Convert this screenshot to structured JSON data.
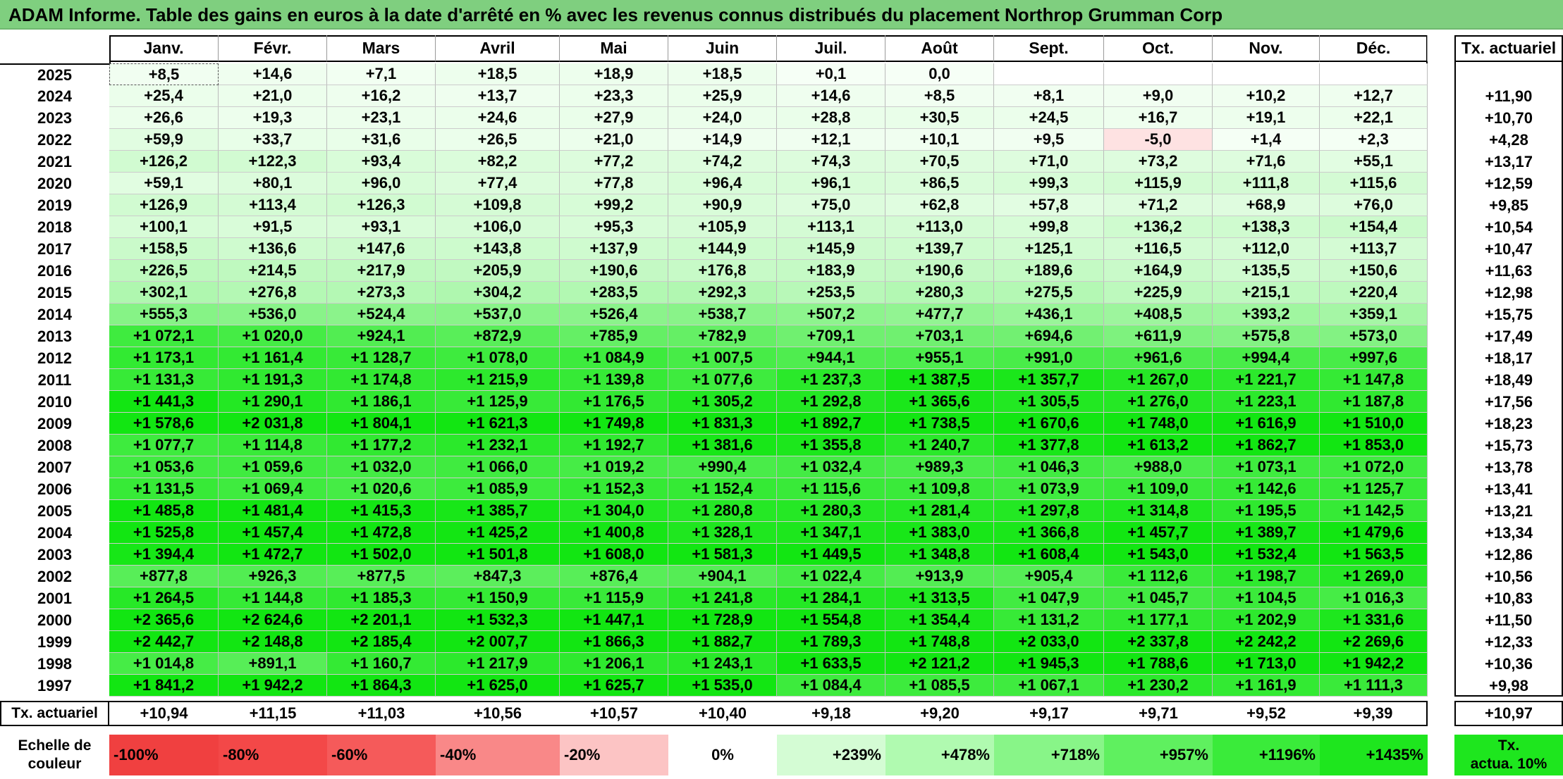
{
  "title": "ADAM Informe. Table des gains en euros à la date d'arrêté en % avec les revenus connus distribués du placement Northrop Grumman Corp",
  "chart_data": {
    "type": "table",
    "columns": [
      "Janv.",
      "Févr.",
      "Mars",
      "Avril",
      "Mai",
      "Juin",
      "Juil.",
      "Août",
      "Sept.",
      "Oct.",
      "Nov.",
      "Déc."
    ],
    "annual_column_label": "Tx. actuariel",
    "rows": [
      {
        "year": "2025",
        "values": [
          "+8,5",
          "+14,6",
          "+7,1",
          "+18,5",
          "+18,9",
          "+18,5",
          "+0,1",
          "0,0",
          "",
          "",
          "",
          ""
        ],
        "annual": ""
      },
      {
        "year": "2024",
        "values": [
          "+25,4",
          "+21,0",
          "+16,2",
          "+13,7",
          "+23,3",
          "+25,9",
          "+14,6",
          "+8,5",
          "+8,1",
          "+9,0",
          "+10,2",
          "+12,7"
        ],
        "annual": "+11,90"
      },
      {
        "year": "2023",
        "values": [
          "+26,6",
          "+19,3",
          "+23,1",
          "+24,6",
          "+27,9",
          "+24,0",
          "+28,8",
          "+30,5",
          "+24,5",
          "+16,7",
          "+19,1",
          "+22,1"
        ],
        "annual": "+10,70"
      },
      {
        "year": "2022",
        "values": [
          "+59,9",
          "+33,7",
          "+31,6",
          "+26,5",
          "+21,0",
          "+14,9",
          "+12,1",
          "+10,1",
          "+9,5",
          "-5,0",
          "+1,4",
          "+2,3"
        ],
        "annual": "+4,28"
      },
      {
        "year": "2021",
        "values": [
          "+126,2",
          "+122,3",
          "+93,4",
          "+82,2",
          "+77,2",
          "+74,2",
          "+74,3",
          "+70,5",
          "+71,0",
          "+73,2",
          "+71,6",
          "+55,1"
        ],
        "annual": "+13,17"
      },
      {
        "year": "2020",
        "values": [
          "+59,1",
          "+80,1",
          "+96,0",
          "+77,4",
          "+77,8",
          "+96,4",
          "+96,1",
          "+86,5",
          "+99,3",
          "+115,9",
          "+111,8",
          "+115,6"
        ],
        "annual": "+12,59"
      },
      {
        "year": "2019",
        "values": [
          "+126,9",
          "+113,4",
          "+126,3",
          "+109,8",
          "+99,2",
          "+90,9",
          "+75,0",
          "+62,8",
          "+57,8",
          "+71,2",
          "+68,9",
          "+76,0"
        ],
        "annual": "+9,85"
      },
      {
        "year": "2018",
        "values": [
          "+100,1",
          "+91,5",
          "+93,1",
          "+106,0",
          "+95,3",
          "+105,9",
          "+113,1",
          "+113,0",
          "+99,8",
          "+136,2",
          "+138,3",
          "+154,4"
        ],
        "annual": "+10,54"
      },
      {
        "year": "2017",
        "values": [
          "+158,5",
          "+136,6",
          "+147,6",
          "+143,8",
          "+137,9",
          "+144,9",
          "+145,9",
          "+139,7",
          "+125,1",
          "+116,5",
          "+112,0",
          "+113,7"
        ],
        "annual": "+10,47"
      },
      {
        "year": "2016",
        "values": [
          "+226,5",
          "+214,5",
          "+217,9",
          "+205,9",
          "+190,6",
          "+176,8",
          "+183,9",
          "+190,6",
          "+189,6",
          "+164,9",
          "+135,5",
          "+150,6"
        ],
        "annual": "+11,63"
      },
      {
        "year": "2015",
        "values": [
          "+302,1",
          "+276,8",
          "+273,3",
          "+304,2",
          "+283,5",
          "+292,3",
          "+253,5",
          "+280,3",
          "+275,5",
          "+225,9",
          "+215,1",
          "+220,4"
        ],
        "annual": "+12,98"
      },
      {
        "year": "2014",
        "values": [
          "+555,3",
          "+536,0",
          "+524,4",
          "+537,0",
          "+526,4",
          "+538,7",
          "+507,2",
          "+477,7",
          "+436,1",
          "+408,5",
          "+393,2",
          "+359,1"
        ],
        "annual": "+15,75"
      },
      {
        "year": "2013",
        "values": [
          "+1 072,1",
          "+1 020,0",
          "+924,1",
          "+872,9",
          "+785,9",
          "+782,9",
          "+709,1",
          "+703,1",
          "+694,6",
          "+611,9",
          "+575,8",
          "+573,0"
        ],
        "annual": "+17,49"
      },
      {
        "year": "2012",
        "values": [
          "+1 173,1",
          "+1 161,4",
          "+1 128,7",
          "+1 078,0",
          "+1 084,9",
          "+1 007,5",
          "+944,1",
          "+955,1",
          "+991,0",
          "+961,6",
          "+994,4",
          "+997,6"
        ],
        "annual": "+18,17"
      },
      {
        "year": "2011",
        "values": [
          "+1 131,3",
          "+1 191,3",
          "+1 174,8",
          "+1 215,9",
          "+1 139,8",
          "+1 077,6",
          "+1 237,3",
          "+1 387,5",
          "+1 357,7",
          "+1 267,0",
          "+1 221,7",
          "+1 147,8"
        ],
        "annual": "+18,49"
      },
      {
        "year": "2010",
        "values": [
          "+1 441,3",
          "+1 290,1",
          "+1 186,1",
          "+1 125,9",
          "+1 176,5",
          "+1 305,2",
          "+1 292,8",
          "+1 365,6",
          "+1 305,5",
          "+1 276,0",
          "+1 223,1",
          "+1 187,8"
        ],
        "annual": "+17,56"
      },
      {
        "year": "2009",
        "values": [
          "+1 578,6",
          "+2 031,8",
          "+1 804,1",
          "+1 621,3",
          "+1 749,8",
          "+1 831,3",
          "+1 892,7",
          "+1 738,5",
          "+1 670,6",
          "+1 748,0",
          "+1 616,9",
          "+1 510,0"
        ],
        "annual": "+18,23"
      },
      {
        "year": "2008",
        "values": [
          "+1 077,7",
          "+1 114,8",
          "+1 177,2",
          "+1 232,1",
          "+1 192,7",
          "+1 381,6",
          "+1 355,8",
          "+1 240,7",
          "+1 377,8",
          "+1 613,2",
          "+1 862,7",
          "+1 853,0"
        ],
        "annual": "+15,73"
      },
      {
        "year": "2007",
        "values": [
          "+1 053,6",
          "+1 059,6",
          "+1 032,0",
          "+1 066,0",
          "+1 019,2",
          "+990,4",
          "+1 032,4",
          "+989,3",
          "+1 046,3",
          "+988,0",
          "+1 073,1",
          "+1 072,0"
        ],
        "annual": "+13,78"
      },
      {
        "year": "2006",
        "values": [
          "+1 131,5",
          "+1 069,4",
          "+1 020,6",
          "+1 085,9",
          "+1 152,3",
          "+1 152,4",
          "+1 115,6",
          "+1 109,8",
          "+1 073,9",
          "+1 109,0",
          "+1 142,6",
          "+1 125,7"
        ],
        "annual": "+13,41"
      },
      {
        "year": "2005",
        "values": [
          "+1 485,8",
          "+1 481,4",
          "+1 415,3",
          "+1 385,7",
          "+1 304,0",
          "+1 280,8",
          "+1 280,3",
          "+1 281,4",
          "+1 297,8",
          "+1 314,8",
          "+1 195,5",
          "+1 142,5"
        ],
        "annual": "+13,21"
      },
      {
        "year": "2004",
        "values": [
          "+1 525,8",
          "+1 457,4",
          "+1 472,8",
          "+1 425,2",
          "+1 400,8",
          "+1 328,1",
          "+1 347,1",
          "+1 383,0",
          "+1 366,8",
          "+1 457,7",
          "+1 389,7",
          "+1 479,6"
        ],
        "annual": "+13,34"
      },
      {
        "year": "2003",
        "values": [
          "+1 394,4",
          "+1 472,7",
          "+1 502,0",
          "+1 501,8",
          "+1 608,0",
          "+1 581,3",
          "+1 449,5",
          "+1 348,8",
          "+1 608,4",
          "+1 543,0",
          "+1 532,4",
          "+1 563,5"
        ],
        "annual": "+12,86"
      },
      {
        "year": "2002",
        "values": [
          "+877,8",
          "+926,3",
          "+877,5",
          "+847,3",
          "+876,4",
          "+904,1",
          "+1 022,4",
          "+913,9",
          "+905,4",
          "+1 112,6",
          "+1 198,7",
          "+1 269,0"
        ],
        "annual": "+10,56"
      },
      {
        "year": "2001",
        "values": [
          "+1 264,5",
          "+1 144,8",
          "+1 185,3",
          "+1 150,9",
          "+1 115,9",
          "+1 241,8",
          "+1 284,1",
          "+1 313,5",
          "+1 047,9",
          "+1 045,7",
          "+1 104,5",
          "+1 016,3"
        ],
        "annual": "+10,83"
      },
      {
        "year": "2000",
        "values": [
          "+2 365,6",
          "+2 624,6",
          "+2 201,1",
          "+1 532,3",
          "+1 447,1",
          "+1 728,9",
          "+1 554,8",
          "+1 354,4",
          "+1 131,2",
          "+1 177,1",
          "+1 202,9",
          "+1 331,6"
        ],
        "annual": "+11,50"
      },
      {
        "year": "1999",
        "values": [
          "+2 442,7",
          "+2 148,8",
          "+2 185,4",
          "+2 007,7",
          "+1 866,3",
          "+1 882,7",
          "+1 789,3",
          "+1 748,8",
          "+2 033,0",
          "+2 337,8",
          "+2 242,2",
          "+2 269,6"
        ],
        "annual": "+12,33"
      },
      {
        "year": "1998",
        "values": [
          "+1 014,8",
          "+891,1",
          "+1 160,7",
          "+1 217,9",
          "+1 206,1",
          "+1 243,1",
          "+1 633,5",
          "+2 121,2",
          "+1 945,3",
          "+1 788,6",
          "+1 713,0",
          "+1 942,2"
        ],
        "annual": "+10,36"
      },
      {
        "year": "1997",
        "values": [
          "+1 841,2",
          "+1 942,2",
          "+1 864,3",
          "+1 625,0",
          "+1 625,7",
          "+1 535,0",
          "+1 084,4",
          "+1 085,5",
          "+1 067,1",
          "+1 230,2",
          "+1 161,9",
          "+1 111,3"
        ],
        "annual": "+9,98"
      }
    ],
    "footer": {
      "label": "Tx. actuariel",
      "values": [
        "+10,94",
        "+11,15",
        "+11,03",
        "+10,56",
        "+10,57",
        "+10,40",
        "+9,18",
        "+9,20",
        "+9,17",
        "+9,71",
        "+9,52",
        "+9,39"
      ],
      "annual": "+10,97"
    },
    "color_scale": {
      "label_line1": "Echelle de",
      "label_line2": "couleur",
      "items": [
        {
          "label": "-100%",
          "color": "#f04040"
        },
        {
          "label": "-80%",
          "color": "#f34848"
        },
        {
          "label": "-60%",
          "color": "#f55a5a"
        },
        {
          "label": "-40%",
          "color": "#f98888"
        },
        {
          "label": "-20%",
          "color": "#fcc4c4"
        },
        {
          "label": "0%",
          "color": "#ffffff"
        },
        {
          "label": "+239%",
          "color": "#d4fcd4"
        },
        {
          "label": "+478%",
          "color": "#b0fab0"
        },
        {
          "label": "+718%",
          "color": "#88f588"
        },
        {
          "label": "+957%",
          "color": "#5ff05f"
        },
        {
          "label": "+1196%",
          "color": "#3aeb3a"
        },
        {
          "label": "+1435%",
          "color": "#1ee61e"
        }
      ],
      "annual_line1": "Tx.",
      "annual_line2": "actua. 10%",
      "annual_color": "#1ee61e"
    }
  }
}
